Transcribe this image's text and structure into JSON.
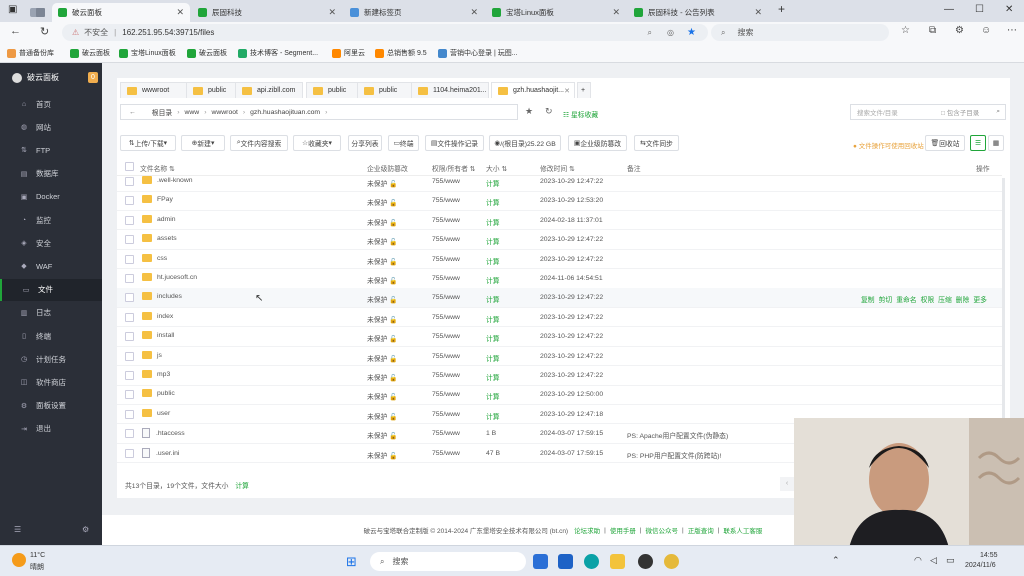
{
  "browser": {
    "tabs": [
      {
        "label": "",
        "active": false
      },
      {
        "label": "",
        "active": false
      },
      {
        "label": "破云面板",
        "active": true
      },
      {
        "label": "辰固科技",
        "active": false
      },
      {
        "label": "新建标签页",
        "active": false
      },
      {
        "label": "宝塔Linux面板",
        "active": false
      },
      {
        "label": "辰固科技 - 公告列表",
        "active": false
      }
    ],
    "new_tab": "+",
    "security": "不安全",
    "url": "162.251.95.54:39715/files",
    "search_placeholder": "搜索",
    "bookmarks": [
      "普通备份库",
      "破云面板",
      "宝塔Linux面板",
      "破云面板",
      "技术博客 - Segment...",
      "阿里云",
      "总销售额 9.5",
      "营销中心登录 | 玩图..."
    ]
  },
  "sidebar": {
    "title": "破云面板",
    "badge": "0",
    "items": [
      {
        "label": "首页",
        "icon": "home-icon"
      },
      {
        "label": "网站",
        "icon": "globe-icon"
      },
      {
        "label": "FTP",
        "icon": "ftp-icon"
      },
      {
        "label": "数据库",
        "icon": "database-icon"
      },
      {
        "label": "Docker",
        "icon": "docker-icon"
      },
      {
        "label": "监控",
        "icon": "monitor-icon"
      },
      {
        "label": "安全",
        "icon": "shield-icon"
      },
      {
        "label": "WAF",
        "icon": "waf-icon"
      },
      {
        "label": "文件",
        "icon": "folder-icon"
      },
      {
        "label": "日志",
        "icon": "log-icon"
      },
      {
        "label": "终端",
        "icon": "terminal-icon"
      },
      {
        "label": "计划任务",
        "icon": "clock-icon"
      },
      {
        "label": "软件商店",
        "icon": "store-icon"
      },
      {
        "label": "面板设置",
        "icon": "settings-icon"
      },
      {
        "label": "退出",
        "icon": "logout-icon"
      }
    ]
  },
  "files": {
    "tabs": [
      "wwwroot",
      "public",
      "api.zibll.com",
      "public",
      "public",
      "1104.heima201...",
      "gzh.huashaojit..."
    ],
    "breadcrumb": [
      "根目录",
      "www",
      "wwwroot",
      "gzh.huashaojituan.com"
    ],
    "search_placeholder": "搜索文件/目录",
    "search_subdir": "包含子目录",
    "toolbar": {
      "upload": "上传/下载",
      "new": "新建",
      "content_search": "文件内容搜索",
      "favorites": "收藏夹",
      "share": "分享列表",
      "terminal": "终端",
      "ops_log": "文件操作记录",
      "disk": "/(根目录)25.22 GB",
      "protect": "企业级防篡改",
      "sync": "文件同步",
      "ops_alert": "文件操作可使用回收站",
      "recycle": "回收站",
      "star": "星标收藏"
    },
    "headers": [
      "文件名称",
      "企业级防篡改",
      "权限/所有者",
      "大小",
      "修改时间",
      "备注",
      "操作"
    ],
    "rows": [
      {
        "name": ".well-known",
        "protect": "未保护",
        "perm": "755/www",
        "size": "计算",
        "time": "2023-10-29 12:47:22",
        "note": "",
        "type": "dir"
      },
      {
        "name": "FPay",
        "protect": "未保护",
        "perm": "755/www",
        "size": "计算",
        "time": "2023-10-29 12:53:20",
        "note": "",
        "type": "dir"
      },
      {
        "name": "admin",
        "protect": "未保护",
        "perm": "755/www",
        "size": "计算",
        "time": "2024-02-18 11:37:01",
        "note": "",
        "type": "dir"
      },
      {
        "name": "assets",
        "protect": "未保护",
        "perm": "755/www",
        "size": "计算",
        "time": "2023-10-29 12:47:22",
        "note": "",
        "type": "dir"
      },
      {
        "name": "css",
        "protect": "未保护",
        "perm": "755/www",
        "size": "计算",
        "time": "2023-10-29 12:47:22",
        "note": "",
        "type": "dir"
      },
      {
        "name": "ht.jucesoft.cn",
        "protect": "未保护",
        "perm": "755/www",
        "size": "计算",
        "time": "2024-11-06 14:54:51",
        "note": "",
        "type": "dir"
      },
      {
        "name": "includes",
        "protect": "未保护",
        "perm": "755/www",
        "size": "计算",
        "time": "2023-10-29 12:47:22",
        "note": "",
        "type": "dir",
        "hover": true
      },
      {
        "name": "index",
        "protect": "未保护",
        "perm": "755/www",
        "size": "计算",
        "time": "2023-10-29 12:47:22",
        "note": "",
        "type": "dir"
      },
      {
        "name": "install",
        "protect": "未保护",
        "perm": "755/www",
        "size": "计算",
        "time": "2023-10-29 12:47:22",
        "note": "",
        "type": "dir"
      },
      {
        "name": "js",
        "protect": "未保护",
        "perm": "755/www",
        "size": "计算",
        "time": "2023-10-29 12:47:22",
        "note": "",
        "type": "dir"
      },
      {
        "name": "mp3",
        "protect": "未保护",
        "perm": "755/www",
        "size": "计算",
        "time": "2023-10-29 12:47:22",
        "note": "",
        "type": "dir"
      },
      {
        "name": "public",
        "protect": "未保护",
        "perm": "755/www",
        "size": "计算",
        "time": "2023-10-29 12:50:00",
        "note": "",
        "type": "dir"
      },
      {
        "name": "user",
        "protect": "未保护",
        "perm": "755/www",
        "size": "计算",
        "time": "2023-10-29 12:47:18",
        "note": "",
        "type": "dir"
      },
      {
        "name": ".htaccess",
        "protect": "未保护",
        "perm": "755/www",
        "size": "1 B",
        "time": "2024-03-07 17:59:15",
        "note": "PS: Apache用户配置文件(伪静态)",
        "type": "file"
      },
      {
        "name": ".user.ini",
        "protect": "未保护",
        "perm": "755/www",
        "size": "47 B",
        "time": "2024-03-07 17:59:15",
        "note": "PS: PHP用户配置文件(防跨站)!",
        "type": "file"
      }
    ],
    "row_actions": [
      "复制",
      "剪切",
      "重命名",
      "权限",
      "压缩",
      "删除",
      "更多"
    ],
    "summary": "共13个目录，19个文件，文件大小",
    "summary_calc": "计算"
  },
  "footer": {
    "copyright": "破云与宝塔联合定制版 © 2014-2024 广东堡塔安全技术有限公司 (bt.cn)",
    "links": [
      "论坛求助",
      "使用手册",
      "微信公众号",
      "正版查询",
      "联系人工客服"
    ]
  },
  "taskbar": {
    "weather_temp": "11°C",
    "weather_desc": "晴朗",
    "search": "搜索",
    "time": "14:55",
    "date": "2024/11/6"
  },
  "colors": {
    "accent": "#20a53a",
    "sidebar": "#2b2f38",
    "folder": "#f5c043"
  }
}
